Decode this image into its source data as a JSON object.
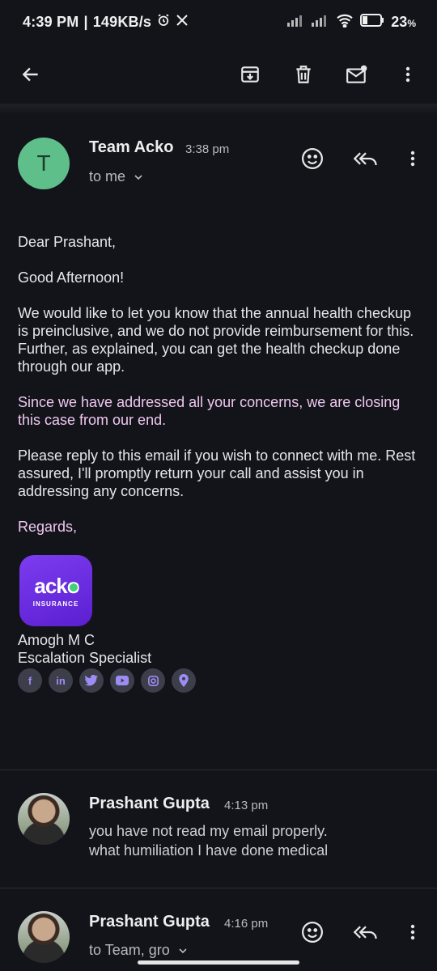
{
  "status_bar": {
    "time": "4:39 PM",
    "speed": "149KB/s",
    "battery": "23"
  },
  "toolbar": {
    "back_icon": "arrow-left-icon",
    "archive_icon": "archive-icon",
    "delete_icon": "trash-icon",
    "unread_icon": "mark-unread-icon",
    "more_icon": "more-vert-icon"
  },
  "message1": {
    "avatar_letter": "T",
    "sender": "Team Acko",
    "time": "3:38 pm",
    "recipients": "to me",
    "body": {
      "greeting": "Dear Prashant,",
      "p1": "Good Afternoon!",
      "p2": "We would like to let you know that the annual health checkup is preinclusive, and we do not provide reimbursement for this. Further, as explained, you can get the health checkup done through our app.",
      "p3": "Since we have addressed all your concerns, we are closing this case from our end.",
      "p4": "Please reply to this email if you wish to connect with me. Rest assured, I'll promptly return your call and assist you in addressing any concerns.",
      "closing": "Regards,"
    },
    "signature": {
      "logo_word": "acko",
      "logo_sub": "INSURANCE",
      "name": "Amogh M C",
      "title": "Escalation Specialist",
      "socials": [
        "facebook-icon",
        "linkedin-icon",
        "twitter-icon",
        "youtube-icon",
        "instagram-icon",
        "location-pin-icon"
      ]
    }
  },
  "message2": {
    "sender": "Prashant Gupta",
    "time": "4:13 pm",
    "snippet_line1": "you have not read my email properly.",
    "snippet_line2": "what humiliation I have done medical"
  },
  "message3": {
    "sender": "Prashant Gupta",
    "time": "4:16 pm",
    "recipients": "to Team, gro"
  },
  "colors": {
    "background": "#12141a",
    "pink_text": "#f0c7f0",
    "avatar_green": "#5fbf8a",
    "acko_purple": "#6a2ae3"
  }
}
